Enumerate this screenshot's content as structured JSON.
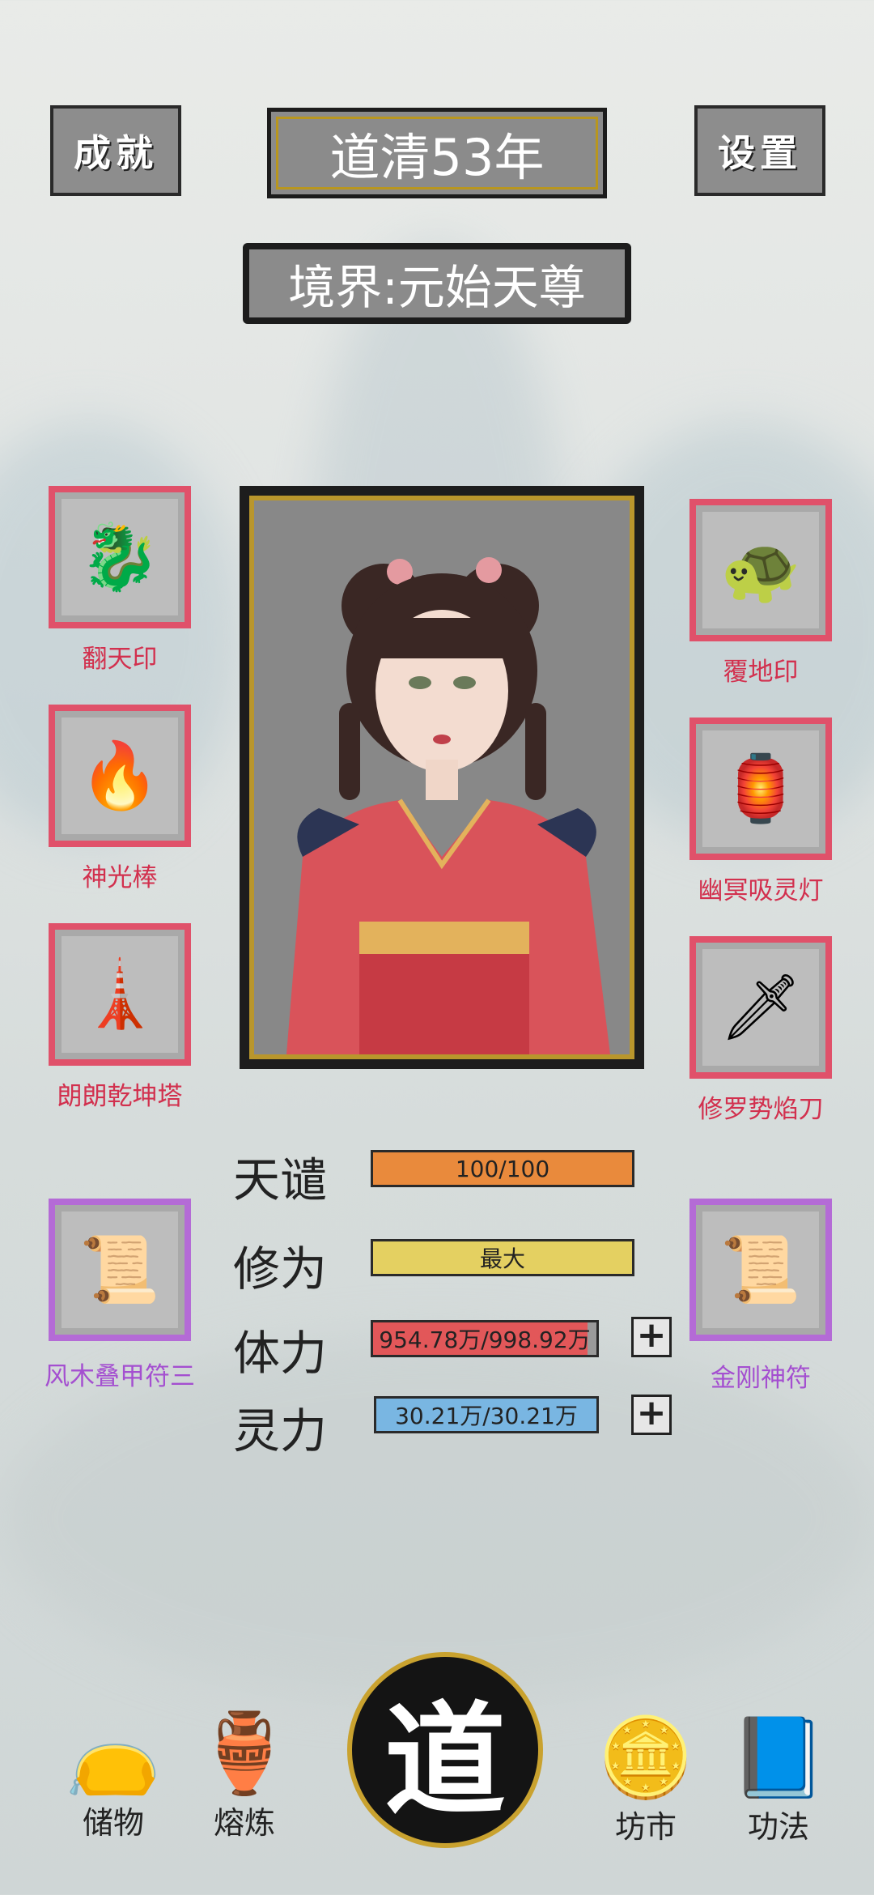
{
  "header": {
    "achievement": "成就",
    "settings": "设置",
    "year": "道清53年",
    "realm": "境界:元始天尊"
  },
  "left_slots": [
    {
      "label": "翻天印",
      "icon": "jade-dragon-seal-icon",
      "glyph": "🐉"
    },
    {
      "label": "神光棒",
      "icon": "fire-staff-icon",
      "glyph": "🔥"
    },
    {
      "label": "朗朗乾坤塔",
      "icon": "pagoda-icon",
      "glyph": "🗼"
    },
    {
      "label": "风木叠甲符三",
      "icon": "talisman-icon",
      "glyph": "📜"
    }
  ],
  "right_slots": [
    {
      "label": "覆地印",
      "icon": "turtle-seal-icon",
      "glyph": "🐢"
    },
    {
      "label": "幽冥吸灵灯",
      "icon": "spirit-lamp-icon",
      "glyph": "🏮"
    },
    {
      "label": "修罗势焰刀",
      "icon": "flame-blade-icon",
      "glyph": "🗡"
    },
    {
      "label": "金刚神符",
      "icon": "talisman-icon",
      "glyph": "📜"
    }
  ],
  "stats": {
    "tianqian": {
      "name": "天谴",
      "value": "100/100",
      "fill": 1.0,
      "color": "#e98a3c"
    },
    "xiuwei": {
      "name": "修为",
      "value": "最大",
      "fill": 1.0,
      "color": "#e4d061"
    },
    "tili": {
      "name": "体力",
      "value": "954.78万/998.92万",
      "fill": 0.956,
      "color": "#e25759"
    },
    "lingli": {
      "name": "灵力",
      "value": "30.21万/30.21万",
      "fill": 1.0,
      "color": "#79b6e2"
    }
  },
  "nav": {
    "storage": "储物",
    "smelt": "熔炼",
    "dao": "道",
    "market": "坊市",
    "techniques": "功法"
  }
}
